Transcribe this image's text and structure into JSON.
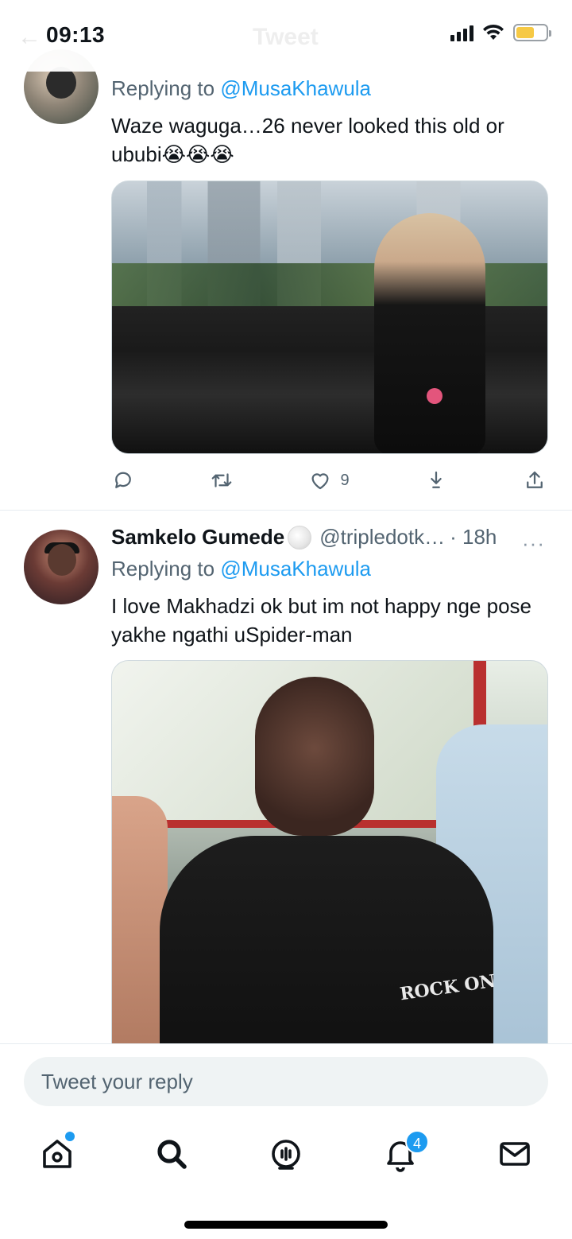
{
  "status_bar": {
    "time": "09:13",
    "ghost_back": "←",
    "ghost_title": "Tweet",
    "icons": [
      "signal-icon",
      "wifi-icon",
      "battery-icon"
    ]
  },
  "tweets": [
    {
      "reply_label": "Replying to",
      "reply_handle": "@MusaKhawula",
      "text": "Waze waguga…26 never looked this old or ububi😭😭😭",
      "media_description_icon": "photo",
      "actions": {
        "reply_count": "",
        "retweet_count": "",
        "like_count": "9",
        "share_count": ""
      }
    },
    {
      "display_name": "Samkelo Gumede",
      "handle": "@tripledotk…",
      "time": "· 18h",
      "more": "···",
      "reply_label": "Replying to",
      "reply_handle": "@MusaKhawula",
      "text": "I love Makhadzi ok but im not happy nge pose yakhe ngathi uSpider-man",
      "media_shirt_text": "ROCK ON"
    }
  ],
  "composer": {
    "placeholder": "Tweet your reply"
  },
  "tabbar": {
    "items": [
      "home-icon",
      "search-icon",
      "spaces-icon",
      "notifications-icon",
      "messages-icon"
    ],
    "notifications_badge": "4"
  },
  "colors": {
    "accent": "#1d9bf0",
    "text": "#0f1419",
    "muted": "#536471",
    "divider": "#e6ecf0"
  }
}
